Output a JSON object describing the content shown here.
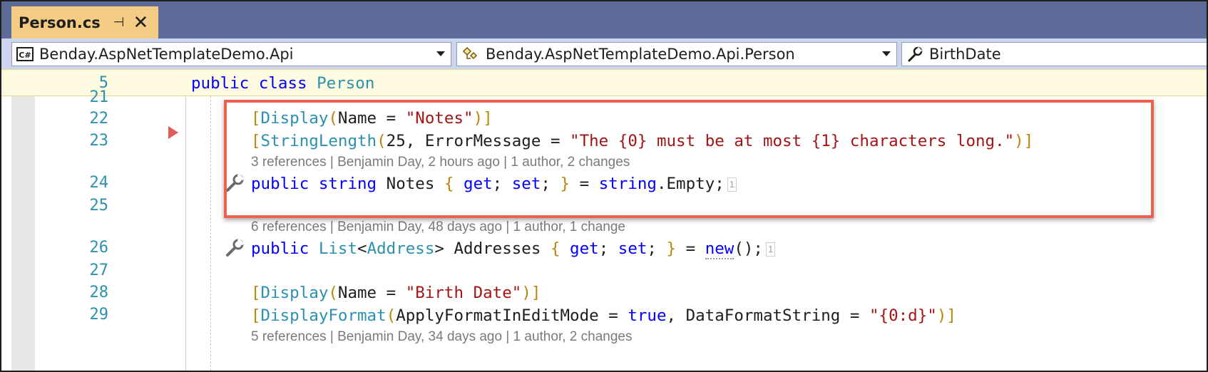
{
  "tab": {
    "title": "Person.cs",
    "pin_icon": "pin-icon",
    "close_icon": "close-icon"
  },
  "navbar": {
    "project": {
      "icon": "csharp-project-icon",
      "label": "Benday.AspNetTemplateDemo.Api"
    },
    "type": {
      "icon": "class-icon",
      "label": "Benday.AspNetTemplateDemo.Api.Person"
    },
    "member": {
      "icon": "wrench-icon",
      "label": "BirthDate"
    }
  },
  "sticky": {
    "line_number": "5",
    "kw1": "public",
    "kw2": "class",
    "name": "Person"
  },
  "lines": {
    "l21": "21",
    "l22": "22",
    "l23": "23",
    "l24": "24",
    "l25": "25",
    "l26": "26",
    "l27": "27",
    "l28": "28",
    "l29": "29"
  },
  "code": {
    "l22": {
      "b1": "[",
      "attr": "Display",
      "p1": "(",
      "arg": "Name = ",
      "str": "\"Notes\"",
      "p2": ")",
      "b2": "]"
    },
    "l23": {
      "b1": "[",
      "attr": "StringLength",
      "p1": "(",
      "arg": "25, ErrorMessage = ",
      "str": "\"The {0} must be at most {1} characters long.\"",
      "p2": ")",
      "b2": "]"
    },
    "lens1": "3 references | Benjamin Day, 2 hours ago | 1 author, 2 changes",
    "l24": {
      "kw1": "public",
      "kw2": "string",
      "name": " Notes ",
      "ob": "{",
      "get": "get",
      "semi1": ";",
      "set": "set",
      "semi2": ";",
      "cb": "}",
      "eq": " = ",
      "kw3": "string",
      "rest": ".Empty;",
      "hint": "1"
    },
    "lens2": "6 references | Benjamin Day, 48 days ago | 1 author, 1 change",
    "l26": {
      "kw1": "public",
      "ty1": "List",
      "lt": "<",
      "ty2": "Address",
      "gt": ">",
      "name": " Addresses ",
      "ob": "{",
      "get": "get",
      "semi1": ";",
      "set": "set",
      "semi2": ";",
      "cb": "}",
      "eq": " = ",
      "kw2": "new",
      "rest": "();",
      "hint": "1"
    },
    "l28": {
      "b1": "[",
      "attr": "Display",
      "p1": "(",
      "arg": "Name = ",
      "str": "\"Birth Date\"",
      "p2": ")",
      "b2": "]"
    },
    "l29": {
      "b1": "[",
      "attr": "DisplayFormat",
      "p1": "(",
      "arg1": "ApplyFormatInEditMode = ",
      "kw": "true",
      "arg2": ", DataFormatString = ",
      "str": "\"{0:d}\"",
      "p2": ")",
      "b2": "]"
    },
    "lens3": "5 references | Benjamin Day, 34 days ago | 1 author, 2 changes"
  },
  "colors": {
    "tab_active": "#f5cc84",
    "tabstrip": "#5d6b99",
    "highlight_box": "#f0604f",
    "keyword": "#0000ff",
    "type": "#2b91af",
    "string": "#a31515"
  }
}
